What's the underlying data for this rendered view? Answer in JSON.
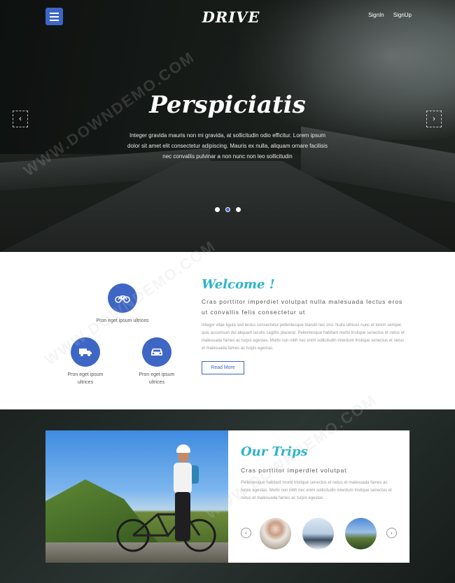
{
  "header": {
    "logo": "DRIVE",
    "signin_label": "SignIn",
    "signup_label": "SignUp"
  },
  "hero": {
    "title": "Perspiciatis",
    "text": "Integer gravida mauris non mi gravida, at sollicitudin odio efficitur. Lorem ipsum dolor sit amet elit consectetur adipiscing. Mauris ex nulla, aliquam ornare facilisis nec convallis pulvinar a non nunc non leo sollicitudin",
    "prev_label": "‹",
    "next_label": "›",
    "slides": 3,
    "active_slide": 2
  },
  "features": [
    {
      "label": "Pron eget ipsum ultrices",
      "icon": "motorcycle-icon"
    },
    {
      "label": "Pron eget ipsum ultrices",
      "icon": "truck-icon"
    },
    {
      "label": "Pron eget ipsum ultrices",
      "icon": "car-icon"
    }
  ],
  "welcome": {
    "title": "Welcome !",
    "subtitle": "Cras porttitor imperdiet volutpat nulla malesuada lectus eros ut convallis felis consectetur ut",
    "body": "Integer vitae ligula sed lectus consectetur pellentesque blandit nec orci. Nulla ultrices nunc et lorem semper, quis accumsan dui aliquam iaculis sagittis placerat. Pellentesque habitant morbi tristique senectus et netus et malesuada fames ac turpis egestas. Morbi non nibh nec enim sollicitudin interdum tristique senectus et netus et malesuada fames ac turpis egestas.",
    "button_label": "Read More"
  },
  "trips": {
    "title": "Our Trips",
    "subtitle": "Cras porttitor imperdiet volutpat",
    "body": "Pellentesque habitant morbi tristique senectus et netus et malesuada fames ac turpis egestas. Morbi non nibh nec enim sollicitudin interdum tristique senectus et netus et malesuada fames ac turpis egestas.",
    "prev_label": "‹",
    "next_label": "›"
  },
  "colors": {
    "accent": "#3e66c4",
    "heading": "#2cb5c8"
  },
  "watermark": "WWW.DOWNDEMO.COM"
}
